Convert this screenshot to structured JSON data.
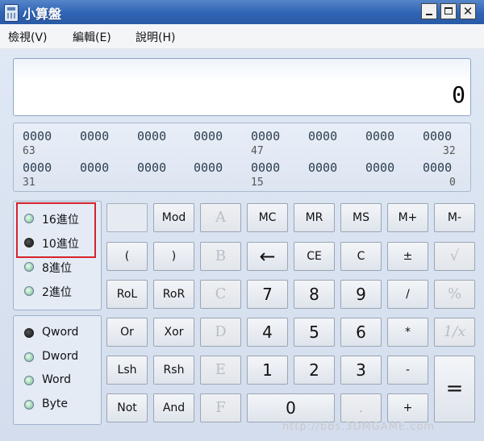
{
  "window": {
    "title": "小算盤"
  },
  "menu": [
    "檢視(V)",
    "編輯(E)",
    "說明(H)"
  ],
  "display": {
    "value": "0"
  },
  "bits": {
    "row1": [
      "0000",
      "0000",
      "0000",
      "0000",
      "0000",
      "0000",
      "0000",
      "0000"
    ],
    "row1_positions": [
      "63",
      "47",
      "32"
    ],
    "row2": [
      "0000",
      "0000",
      "0000",
      "0000",
      "0000",
      "0000",
      "0000",
      "0000"
    ],
    "row2_positions": [
      "31",
      "15",
      "0"
    ]
  },
  "radix": {
    "options": [
      "16進位",
      "10進位",
      "8進位",
      "2進位"
    ],
    "selected": "10進位"
  },
  "word_size": {
    "options": [
      "Qword",
      "Dword",
      "Word",
      "Byte"
    ],
    "selected": "Qword"
  },
  "keys": {
    "mod": "Mod",
    "A": "A",
    "mc": "MC",
    "mr": "MR",
    "ms": "MS",
    "mplus": "M+",
    "mminus": "M-",
    "lparen": "(",
    "rparen": ")",
    "B": "B",
    "back": "←",
    "ce": "CE",
    "c": "C",
    "pm": "±",
    "sqrt": "√",
    "rol": "RoL",
    "ror": "RoR",
    "C_hex": "C",
    "n7": "7",
    "n8": "8",
    "n9": "9",
    "div": "/",
    "pct": "%",
    "or": "Or",
    "xor": "Xor",
    "D": "D",
    "n4": "4",
    "n5": "5",
    "n6": "6",
    "mul": "*",
    "recip": "1/x",
    "lsh": "Lsh",
    "rsh": "Rsh",
    "E": "E",
    "n1": "1",
    "n2": "2",
    "n3": "3",
    "sub": "-",
    "eq": "=",
    "not": "Not",
    "and": "And",
    "F": "F",
    "n0": "0",
    "dot": ".",
    "add": "+"
  },
  "watermark": "http://bbs.3DMGAME.com"
}
